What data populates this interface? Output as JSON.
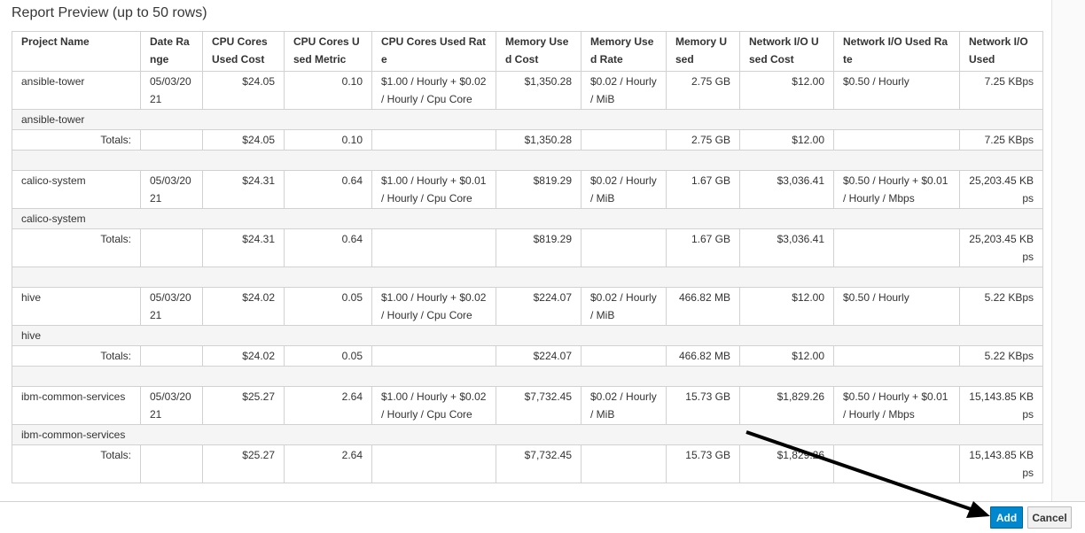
{
  "report": {
    "title": "Report Preview (up to 50 rows)",
    "columns": [
      "Project Name",
      "Date Range",
      "CPU Cores Used Cost",
      "CPU Cores Used Metric",
      "CPU Cores Used Rate",
      "Memory Used Cost",
      "Memory Used Rate",
      "Memory Used",
      "Network I/O Used Cost",
      "Network I/O Used Rate",
      "Network I/O Used"
    ],
    "groups": [
      {
        "project": "ansible-tower",
        "row": [
          "ansible-tower",
          "05/03/2021",
          "$24.05",
          "0.10",
          "$1.00 / Hourly + $0.02 / Hourly / Cpu Core",
          "$1,350.28",
          "$0.02 / Hourly / MiB",
          "2.75 GB",
          "$12.00",
          "$0.50 / Hourly",
          "7.25 KBps"
        ],
        "totals_label": "Totals:",
        "totals": [
          "",
          "$24.05",
          "0.10",
          "",
          "$1,350.28",
          "",
          "2.75 GB",
          "$12.00",
          "",
          "7.25 KBps"
        ]
      },
      {
        "project": "calico-system",
        "row": [
          "calico-system",
          "05/03/2021",
          "$24.31",
          "0.64",
          "$1.00 / Hourly + $0.01 / Hourly / Cpu Core",
          "$819.29",
          "$0.02 / Hourly / MiB",
          "1.67 GB",
          "$3,036.41",
          "$0.50 / Hourly + $0.01 / Hourly / Mbps",
          "25,203.45 KBps"
        ],
        "totals_label": "Totals:",
        "totals": [
          "",
          "$24.31",
          "0.64",
          "",
          "$819.29",
          "",
          "1.67 GB",
          "$3,036.41",
          "",
          "25,203.45 KBps"
        ]
      },
      {
        "project": "hive",
        "row": [
          "hive",
          "05/03/2021",
          "$24.02",
          "0.05",
          "$1.00 / Hourly + $0.02 / Hourly / Cpu Core",
          "$224.07",
          "$0.02 / Hourly / MiB",
          "466.82 MB",
          "$12.00",
          "$0.50 / Hourly",
          "5.22 KBps"
        ],
        "totals_label": "Totals:",
        "totals": [
          "",
          "$24.02",
          "0.05",
          "",
          "$224.07",
          "",
          "466.82 MB",
          "$12.00",
          "",
          "5.22 KBps"
        ]
      },
      {
        "project": "ibm-common-services",
        "row": [
          "ibm-common-services",
          "05/03/2021",
          "$25.27",
          "2.64",
          "$1.00 / Hourly + $0.02 / Hourly / Cpu Core",
          "$7,732.45",
          "$0.02 / Hourly / MiB",
          "15.73 GB",
          "$1,829.26",
          "$0.50 / Hourly + $0.01 / Hourly / Mbps",
          "15,143.85 KBps"
        ],
        "totals_label": "Totals:",
        "totals": [
          "",
          "$25.27",
          "2.64",
          "",
          "$7,732.45",
          "",
          "15.73 GB",
          "$1,829.26",
          "",
          "15,143.85 KBps"
        ]
      }
    ]
  },
  "footer": {
    "add_label": "Add",
    "cancel_label": "Cancel"
  },
  "colors": {
    "primary": "#0088ce",
    "arrow": "#000000"
  }
}
